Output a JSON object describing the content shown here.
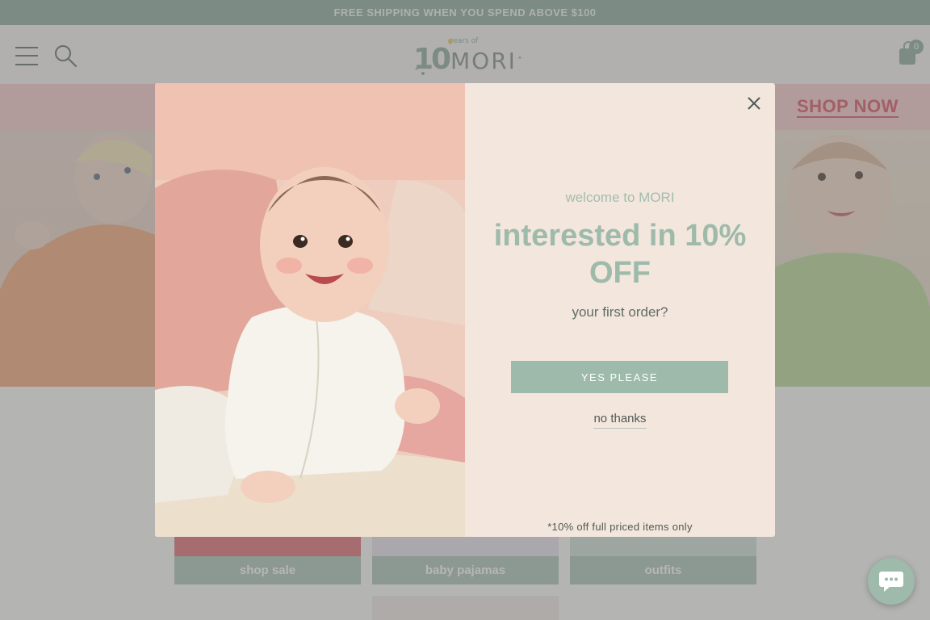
{
  "announcement": {
    "text": "FREE SHIPPING WHEN YOU SPEND ABOVE $100"
  },
  "header": {
    "logo": {
      "brand": "MORI",
      "numeral": "10",
      "tagline": "years of"
    },
    "bag_count": "0",
    "icons": {
      "menu": "hamburger-icon",
      "search": "search-icon",
      "bag": "shopping-bag-icon"
    }
  },
  "promo": {
    "cta": "SHOP NOW"
  },
  "tiles": [
    {
      "label": "shop sale"
    },
    {
      "label": "baby pajamas"
    },
    {
      "label": "outfits"
    }
  ],
  "modal": {
    "welcome": "welcome to MORI",
    "headline": "interested in 10% OFF",
    "subline": "your first order?",
    "yes_button": "YES PLEASE",
    "no_thanks": "no thanks",
    "fine_print": "*10% off full priced items only",
    "close_icon": "close-icon"
  },
  "chat": {
    "icon": "chat-bubble-icon"
  },
  "colors": {
    "sage": "#8aa89a",
    "sage_light": "#9dbaab",
    "coral": "#d9515e",
    "pink": "#f4c8c9",
    "cream": "#f3e6dd"
  }
}
